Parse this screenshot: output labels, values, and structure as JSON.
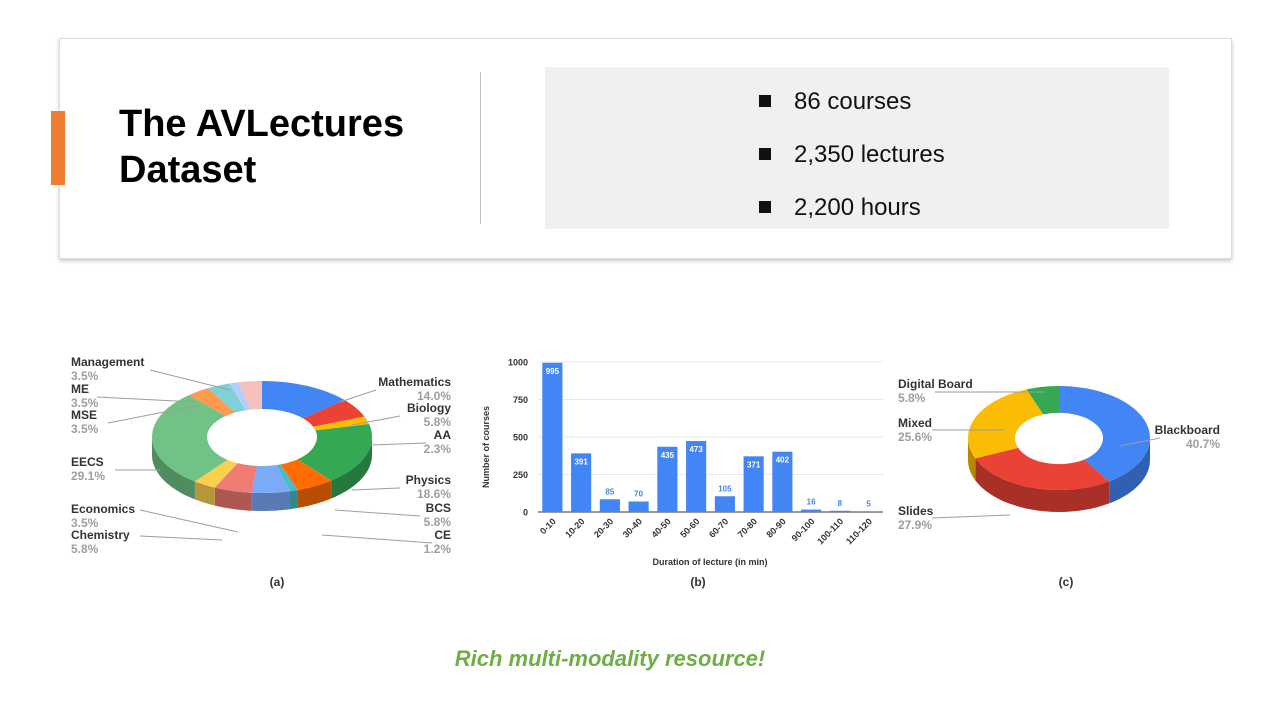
{
  "header": {
    "title": "The AVLectures Dataset",
    "stats": [
      "86 courses",
      "2,350 lectures",
      "2,200 hours"
    ]
  },
  "tagline": "Rich multi-modality resource!",
  "colors": {
    "accent": "#ed7d31",
    "bar": "#4285f4",
    "tagline": "#70ad47"
  },
  "chart_data": [
    {
      "type": "pie",
      "caption": "(a)",
      "slices": [
        {
          "label": "Mathematics",
          "percent": "14.0%",
          "value": 14.0,
          "color": "#4285f4"
        },
        {
          "label": "Biology",
          "percent": "5.8%",
          "value": 5.8,
          "color": "#ea4335"
        },
        {
          "label": "AA",
          "percent": "2.3%",
          "value": 2.3,
          "color": "#fbbc04"
        },
        {
          "label": "Physics",
          "percent": "18.6%",
          "value": 18.6,
          "color": "#34a853"
        },
        {
          "label": "BCS",
          "percent": "5.8%",
          "value": 5.8,
          "color": "#ff6d01"
        },
        {
          "label": "CE",
          "percent": "1.2%",
          "value": 1.2,
          "color": "#46bdc6"
        },
        {
          "label": "",
          "percent": "",
          "value": 5.8,
          "color": "#7baaf7"
        },
        {
          "label": "Chemistry",
          "percent": "5.8%",
          "value": 5.8,
          "color": "#f07b72"
        },
        {
          "label": "Economics",
          "percent": "3.5%",
          "value": 3.5,
          "color": "#fcd04f"
        },
        {
          "label": "EECS",
          "percent": "29.1%",
          "value": 29.1,
          "color": "#71c287"
        },
        {
          "label": "MSE",
          "percent": "3.5%",
          "value": 3.5,
          "color": "#ff994d"
        },
        {
          "label": "ME",
          "percent": "3.5%",
          "value": 3.5,
          "color": "#7ed1d7"
        },
        {
          "label": "",
          "percent": "",
          "value": 1.5,
          "color": "#b3cefb"
        },
        {
          "label": "Management",
          "percent": "3.5%",
          "value": 3.5,
          "color": "#f7c1bb"
        }
      ]
    },
    {
      "type": "bar",
      "caption": "(b)",
      "categories": [
        "0-10",
        "10-20",
        "20-30",
        "30-40",
        "40-50",
        "50-60",
        "60-70",
        "70-80",
        "80-90",
        "90-100",
        "100-110",
        "110-120"
      ],
      "values": [
        995,
        391,
        85,
        70,
        435,
        473,
        105,
        371,
        402,
        16,
        8,
        5
      ],
      "xlabel": "Duration of lecture (in min)",
      "ylabel": "Number of courses",
      "ylim": [
        0,
        1000
      ],
      "yticks": [
        0,
        250,
        500,
        750,
        1000
      ]
    },
    {
      "type": "pie",
      "caption": "(c)",
      "slices": [
        {
          "label": "Blackboard",
          "percent": "40.7%",
          "value": 40.7,
          "color": "#4285f4"
        },
        {
          "label": "Slides",
          "percent": "27.9%",
          "value": 27.9,
          "color": "#ea4335"
        },
        {
          "label": "Mixed",
          "percent": "25.6%",
          "value": 25.6,
          "color": "#fbbc04"
        },
        {
          "label": "Digital Board",
          "percent": "5.8%",
          "value": 5.8,
          "color": "#34a853"
        }
      ]
    }
  ]
}
